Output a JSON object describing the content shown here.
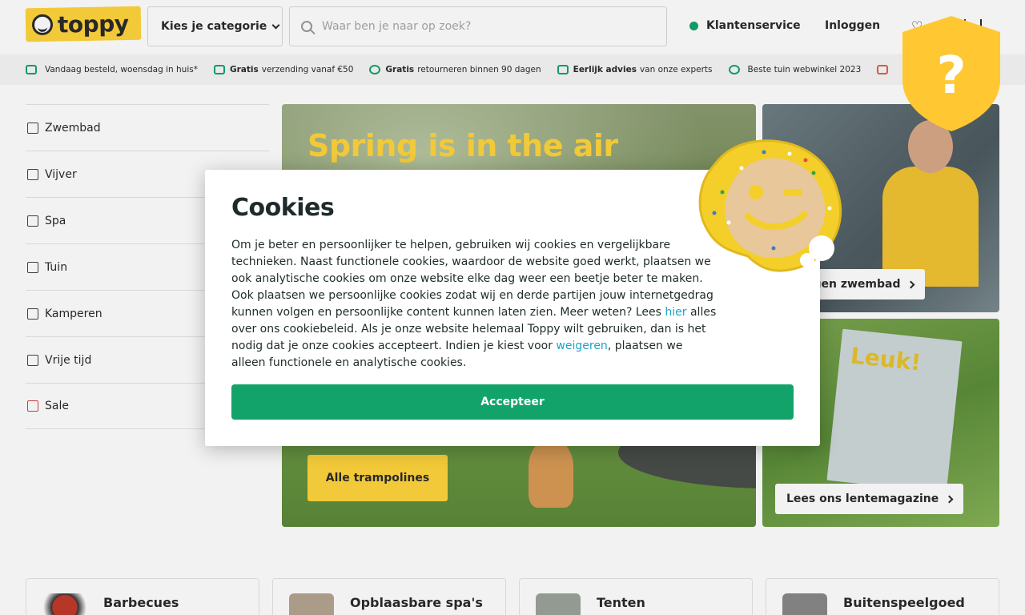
{
  "header": {
    "logo_text": "toppy",
    "category_label": "Kies je categorie",
    "search_placeholder": "Waar ben je naar op zoek?",
    "customer_service": "Klantenservice",
    "login": "Inloggen"
  },
  "usp": [
    {
      "bold": "",
      "text": "Vandaag besteld, woensdag in huis*"
    },
    {
      "bold": "Gratis",
      "text": "verzending vanaf €50"
    },
    {
      "bold": "Gratis",
      "text": "retourneren binnen 90 dagen"
    },
    {
      "bold": "Eerlijk advies",
      "text": "van onze experts"
    },
    {
      "bold": "",
      "text": "Beste tuin webwinkel 2023"
    }
  ],
  "sidebar": {
    "items": [
      {
        "label": "Zwembad",
        "icon": "pool-ladder-icon"
      },
      {
        "label": "Vijver",
        "icon": "fish-icon"
      },
      {
        "label": "Spa",
        "icon": "spa-icon"
      },
      {
        "label": "Tuin",
        "icon": "garden-icon"
      },
      {
        "label": "Kamperen",
        "icon": "tent-icon"
      },
      {
        "label": "Vrije tijd",
        "icon": "person-walking-icon"
      },
      {
        "label": "Sale",
        "icon": "megaphone-icon"
      }
    ]
  },
  "hero": {
    "title": "Spring is in the air",
    "button": "Alle trampolines"
  },
  "cards": [
    {
      "label": "je eigen zwembad"
    },
    {
      "label": "Lees ons lentemagazine",
      "magazine_title": "Leuk!"
    }
  ],
  "tiles": [
    {
      "label": "Barbecues"
    },
    {
      "label": "Opblaasbare spa's"
    },
    {
      "label": "Tenten"
    },
    {
      "label": "Buitenspeelgoed"
    }
  ],
  "cookie_modal": {
    "title": "Cookies",
    "body_1": "Om je beter en persoonlijker te helpen, gebruiken wij cookies en vergelijkbare technieken. Naast functionele cookies, waardoor de website goed werkt, plaatsen we ook analytische cookies om onze website elke dag weer een beetje beter te maken. Ook plaatsen we persoonlijke cookies zodat wij en derde partijen jouw internetgedrag kunnen volgen en persoonlijke content kunnen laten zien. Meer weten? Lees ",
    "link_here": "hier",
    "body_2": " alles over ons cookiebeleid. Als je onze website helemaal Toppy wilt gebruiken, dan is het nodig dat je onze cookies accepteert. Indien je kiest voor ",
    "link_refuse": "weigeren",
    "body_3": ", plaatsen we alleen functionele en analytische cookies.",
    "accept_label": "Accepteer"
  },
  "badge": {
    "symbol": "?"
  },
  "colors": {
    "brand_yellow": "#ffd43b",
    "accent_green": "#12a36b",
    "link_blue": "#1ea3c8"
  }
}
